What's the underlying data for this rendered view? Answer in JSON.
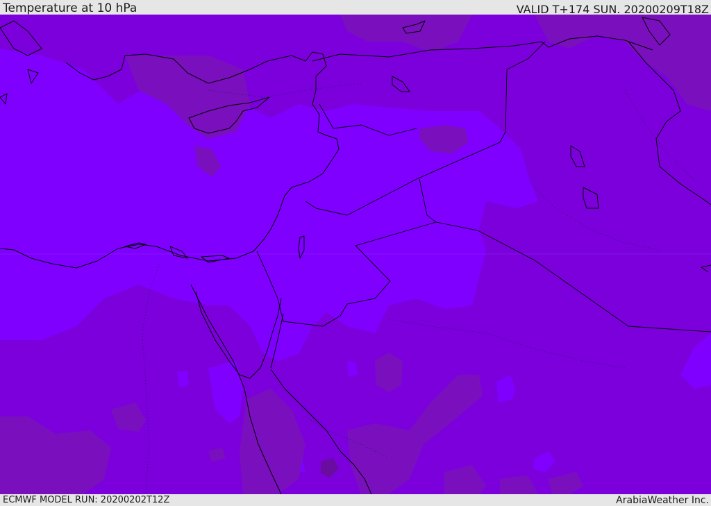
{
  "header": {
    "title": "Temperature at 10 hPa",
    "valid": "VALID T+174 SUN. 20200209T18Z"
  },
  "footer": {
    "model_run": "ECMWF MODEL RUN: 20200202T12Z",
    "credit": "ArabiaWeather Inc."
  },
  "map": {
    "region": "Eastern Mediterranean and Middle East",
    "colors": {
      "background": "#7c00dc",
      "warm_band": "#8000ff",
      "cold_patch": "#7a10bd",
      "coldest_patch": "#6a0ca0",
      "coastline": "#000000"
    }
  }
}
